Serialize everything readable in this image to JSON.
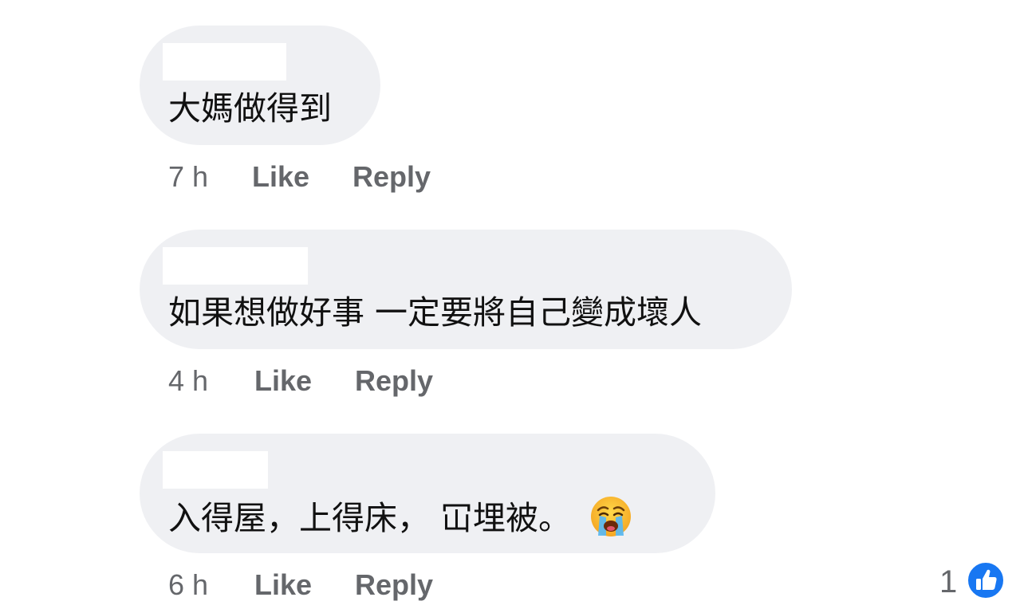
{
  "comments": [
    {
      "text": "大媽做得到",
      "time": "7 h",
      "like_label": "Like",
      "reply_label": "Reply"
    },
    {
      "text": "如果想做好事 一定要將自己變成壞人",
      "time": "4 h",
      "like_label": "Like",
      "reply_label": "Reply"
    },
    {
      "text": "入得屋，上得床，  冚埋被。",
      "emoji": "crying-face-icon",
      "time": "6 h",
      "like_label": "Like",
      "reply_label": "Reply"
    }
  ],
  "reaction": {
    "count": "1",
    "icon": "thumbs-up-icon",
    "color": "#1877f2"
  },
  "colors": {
    "bubble": "#eff0f3",
    "meta_text": "#65676b",
    "body_text": "#111111"
  }
}
